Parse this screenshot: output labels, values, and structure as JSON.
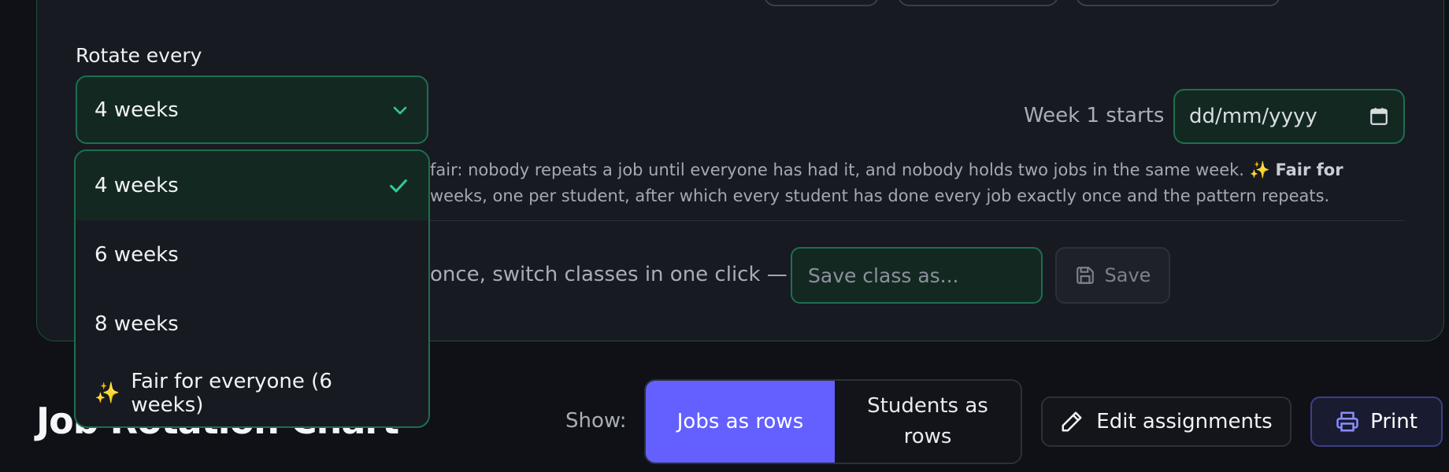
{
  "rotation": {
    "label": "Rotate every",
    "selected": "4 weeks",
    "options": [
      {
        "label": "4 weeks"
      },
      {
        "label": "6 weeks"
      },
      {
        "label": "8 weeks"
      },
      {
        "label": "Fair for everyone (6 weeks)",
        "icon": "sparkles-icon"
      }
    ]
  },
  "week_start": {
    "label": "Week 1 starts",
    "placeholder": "dd/mm/yyyy"
  },
  "description": {
    "line1": "fair: nobody repeats a job until everyone has had it, and nobody holds two jobs in the same week.",
    "line1_bold": "Fair for",
    "line2": "weeks, one per student, after which every student has done every job exactly once and the pattern repeats."
  },
  "save_class": {
    "note": "once, switch classes in one click —",
    "placeholder": "Save class as...",
    "button": "Save"
  },
  "chart": {
    "title": "Job Rotation Chart"
  },
  "view": {
    "show_label": "Show:",
    "jobs_rows": "Jobs as rows",
    "students_rows": "Students as rows"
  },
  "actions": {
    "edit": "Edit assignments",
    "print": "Print"
  },
  "colors": {
    "accent_green": "#2ecc8f",
    "accent_purple": "#6360ff"
  }
}
